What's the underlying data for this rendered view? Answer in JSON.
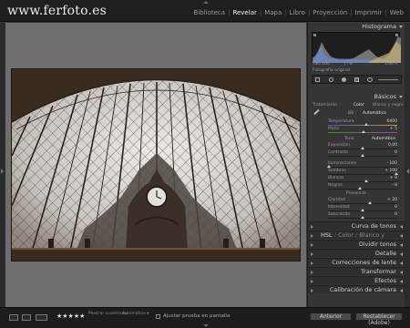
{
  "header": {
    "brand": "www.ferfoto.es",
    "modules": [
      "Biblioteca",
      "Revelar",
      "Mapa",
      "Libro",
      "Proyección",
      "Imprimir",
      "Web"
    ],
    "active_module": "Revelar"
  },
  "panels": {
    "histogram": {
      "title": "Histograma",
      "foot_left": "1/60 s",
      "foot_mid": "ƒ / 8",
      "foot_right": "ISO 100",
      "original_label": "Fotografía original"
    },
    "basic": {
      "title": "Básicos",
      "treatment_label": "Tratamiento :",
      "treatment_color": "Color",
      "treatment_bw": "Blanco y negro",
      "wb_label": "BB :",
      "wb_value": "Automático",
      "temp_label": "Temperatura",
      "temp_value": "6400",
      "tint_label": "Matiz",
      "tint_value": "+ 5",
      "tone_label": "Tono",
      "tone_auto": "Automático",
      "exposure_label": "Exposición",
      "exposure_value": "0,00",
      "contrast_label": "Contraste",
      "contrast_value": "0",
      "highlights_label": "Iluminaciones",
      "highlights_value": "- 100",
      "shadows_label": "Sombras",
      "shadows_value": "+ 100",
      "whites_label": "Blancos",
      "whites_value": "+ 9",
      "blacks_label": "Negros",
      "blacks_value": "- 8",
      "presence_label": "Presencia",
      "clarity_label": "Claridad",
      "clarity_value": "+ 20",
      "vibrance_label": "Intensidad",
      "vibrance_value": "0",
      "saturation_label": "Saturación",
      "saturation_value": "0"
    },
    "tone_curve": "Curva de tonos",
    "hsl": {
      "a": "HSL",
      "b": "Color",
      "c": "Blanco y negro"
    },
    "split_toning": "Dividir tonos",
    "detail": "Detalle",
    "lens": "Correcciones de lente",
    "transform": "Transformar",
    "effects": "Efectos",
    "calibration": "Calibración de cámara"
  },
  "toolbar": {
    "soft_proof_label": "Ajustar prueba en pantalla",
    "small_left_1": "Mostrar cuadrícula",
    "small_left_2": "Automático ▾",
    "stars": "★★★★★"
  },
  "buttons": {
    "previous": "Anterior",
    "reset": "Restablecer (Adobe)"
  }
}
